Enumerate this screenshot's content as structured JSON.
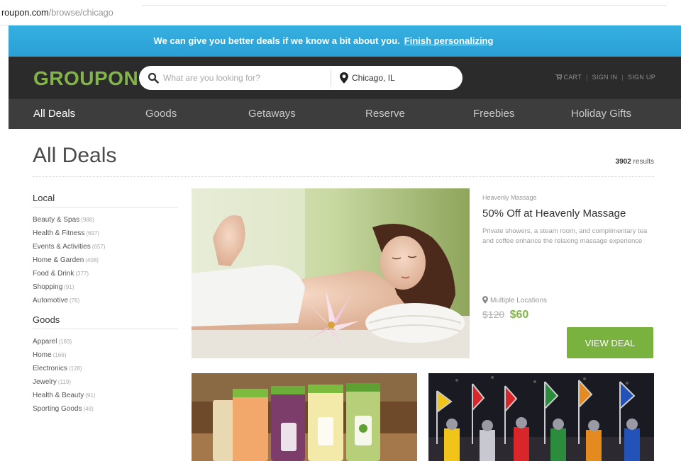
{
  "url": {
    "host": "roupon.com",
    "path": "/browse/chicago"
  },
  "banner": {
    "message": "We can give you better deals if we know a bit about you.",
    "link": "Finish personalizing"
  },
  "header": {
    "logo": "GROUPON",
    "search_placeholder": "What are you looking for?",
    "location": "Chicago, IL",
    "cart": "CART",
    "sign_in": "SIGN IN",
    "sign_up": "SIGN UP"
  },
  "nav": {
    "tabs": [
      "All Deals",
      "Goods",
      "Getaways",
      "Reserve",
      "Freebies",
      "Holiday Gifts"
    ],
    "active": "All Deals"
  },
  "page": {
    "title": "All Deals",
    "results_count": "3902",
    "results_label": "results"
  },
  "sidebar": {
    "sections": [
      {
        "heading": "Local",
        "items": [
          {
            "label": "Beauty & Spas",
            "count": "(988)"
          },
          {
            "label": "Health & Fitness",
            "count": "(697)"
          },
          {
            "label": "Events & Activities",
            "count": "(657)"
          },
          {
            "label": "Home & Garden",
            "count": "(408)"
          },
          {
            "label": "Food & Drink",
            "count": "(377)"
          },
          {
            "label": "Shopping",
            "count": "(91)"
          },
          {
            "label": "Automotive",
            "count": "(76)"
          }
        ]
      },
      {
        "heading": "Goods",
        "items": [
          {
            "label": "Apparel",
            "count": "(183)"
          },
          {
            "label": "Home",
            "count": "(166)"
          },
          {
            "label": "Electronics",
            "count": "(128)"
          },
          {
            "label": "Jewelry",
            "count": "(119)"
          },
          {
            "label": "Health & Beauty",
            "count": "(91)"
          },
          {
            "label": "Sporting Goods",
            "count": "(48)"
          }
        ]
      }
    ]
  },
  "featured_deal": {
    "merchant": "Heavenly Massage",
    "title": "50% Off at Heavenly Massage",
    "description": "Private showers, a steam room, and complimentary tea and coffee enhance the relaxing massage experience",
    "location": "Multiple Locations",
    "original_price": "$120",
    "price": "$60",
    "cta": "VIEW DEAL"
  },
  "colors": {
    "brand_green": "#82b548",
    "banner_blue": "#2a9fd6",
    "header_dark": "#2b2b2b",
    "nav_dark": "#3d3d3d",
    "cta_green": "#79b23f"
  },
  "icons": {
    "search": "search-icon",
    "location": "location-pin-icon",
    "cart": "cart-icon"
  }
}
